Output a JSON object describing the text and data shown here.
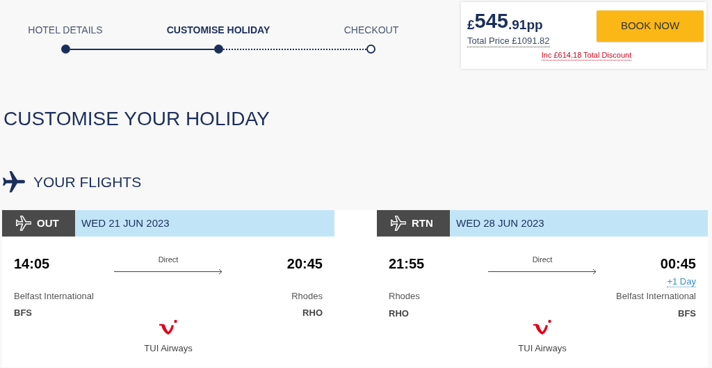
{
  "steps": [
    {
      "label": "HOTEL DETAILS",
      "completed": true,
      "selected": false
    },
    {
      "label": "CUSTOMISE HOLIDAY",
      "completed": true,
      "selected": true
    },
    {
      "label": "CHECKOUT",
      "completed": false,
      "selected": false
    }
  ],
  "price_summary": {
    "price": {
      "currency": "£",
      "amount": "545",
      "decimals": ".91",
      "unit": "pp"
    },
    "total": "Total Price £1091.82",
    "button": "BOOK NOW",
    "discount": "Inc £614.18 Total Discount"
  },
  "page_title": "CUSTOMISE YOUR HOLIDAY",
  "section_title": "YOUR FLIGHTS",
  "flights": [
    {
      "direction": "OUT",
      "date": "WED 21 JUN 2023",
      "depart_time": "14:05",
      "arrive_time": "20:45",
      "stops": "Direct",
      "from_name": "Belfast International",
      "from_code": "BFS",
      "to_name": "Rhodes",
      "to_code": "RHO",
      "airline": "TUI Airways"
    },
    {
      "direction": "RTN",
      "date": "WED 28 JUN 2023",
      "depart_time": "21:55",
      "arrive_time": "00:45",
      "day_offset": "+1 Day",
      "stops": "Direct",
      "from_name": "Rhodes",
      "from_code": "RHO",
      "to_name": "Belfast International",
      "to_code": "BFS",
      "airline": "TUI Airways"
    }
  ]
}
